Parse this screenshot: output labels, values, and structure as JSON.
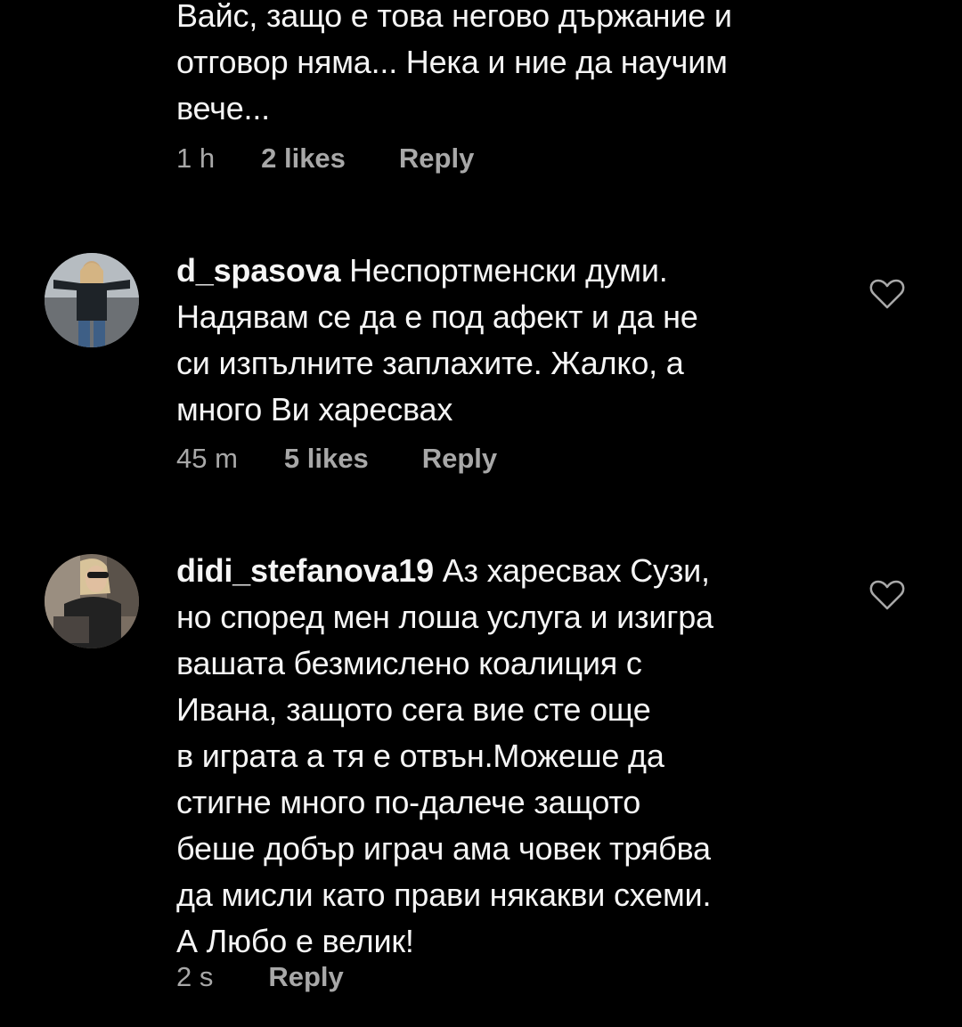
{
  "comments": [
    {
      "username": "",
      "text": "Вайс, защо е това негово държание и\nотговор няма... Нека и ние да научим\nвече...",
      "time": "1 h",
      "likes": "2 likes",
      "reply": "Reply"
    },
    {
      "username": "d_spasova",
      "text": " Неспортменски думи.\nНадявам се да е под афект и да не\nси изпълните заплахите. Жалко, а\nмного Ви харесвах",
      "time": "45 m",
      "likes": "5 likes",
      "reply": "Reply",
      "avatar_icon": "user-avatar-photo"
    },
    {
      "username": "didi_stefanova19",
      "text": " Аз харесвах Сузи,\nно според мен лоша услуга и изигра\nвашата безмислено коалиция с\nИвана, защото сега вие сте още\nв играта а тя е отвън.Можеше да\nстигне  много по-далече защото\nбеше добър играч ама човек трябва\nда мисли като прави някакви схеми.\nА Любо е велик!",
      "time": "2 s",
      "reply": "Reply",
      "avatar_icon": "user-avatar-photo"
    }
  ],
  "colors": {
    "background": "#000000",
    "text": "#f5f5f5",
    "meta": "#a8a8a8"
  },
  "icons": {
    "like": "heart-outline-icon"
  }
}
